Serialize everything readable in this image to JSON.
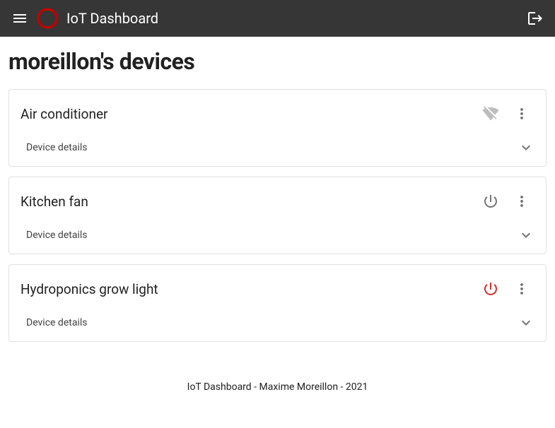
{
  "app": {
    "title": "IoT Dashboard"
  },
  "page": {
    "title": "moreillon's devices"
  },
  "devices": [
    {
      "name": "Air conditioner",
      "details_label": "Device details",
      "status_icon": "wifi-off",
      "status_color": "#bdbdbd"
    },
    {
      "name": "Kitchen fan",
      "details_label": "Device details",
      "status_icon": "power",
      "status_color": "#757575"
    },
    {
      "name": "Hydroponics grow light",
      "details_label": "Device details",
      "status_icon": "power",
      "status_color": "#d32f2f"
    }
  ],
  "footer": {
    "text": "IoT Dashboard - Maxime Moreillon - 2021"
  },
  "colors": {
    "appbar": "#363636",
    "logo": "#c00000",
    "icon_grey": "#757575",
    "icon_light": "#bdbdbd",
    "red": "#d32f2f"
  }
}
